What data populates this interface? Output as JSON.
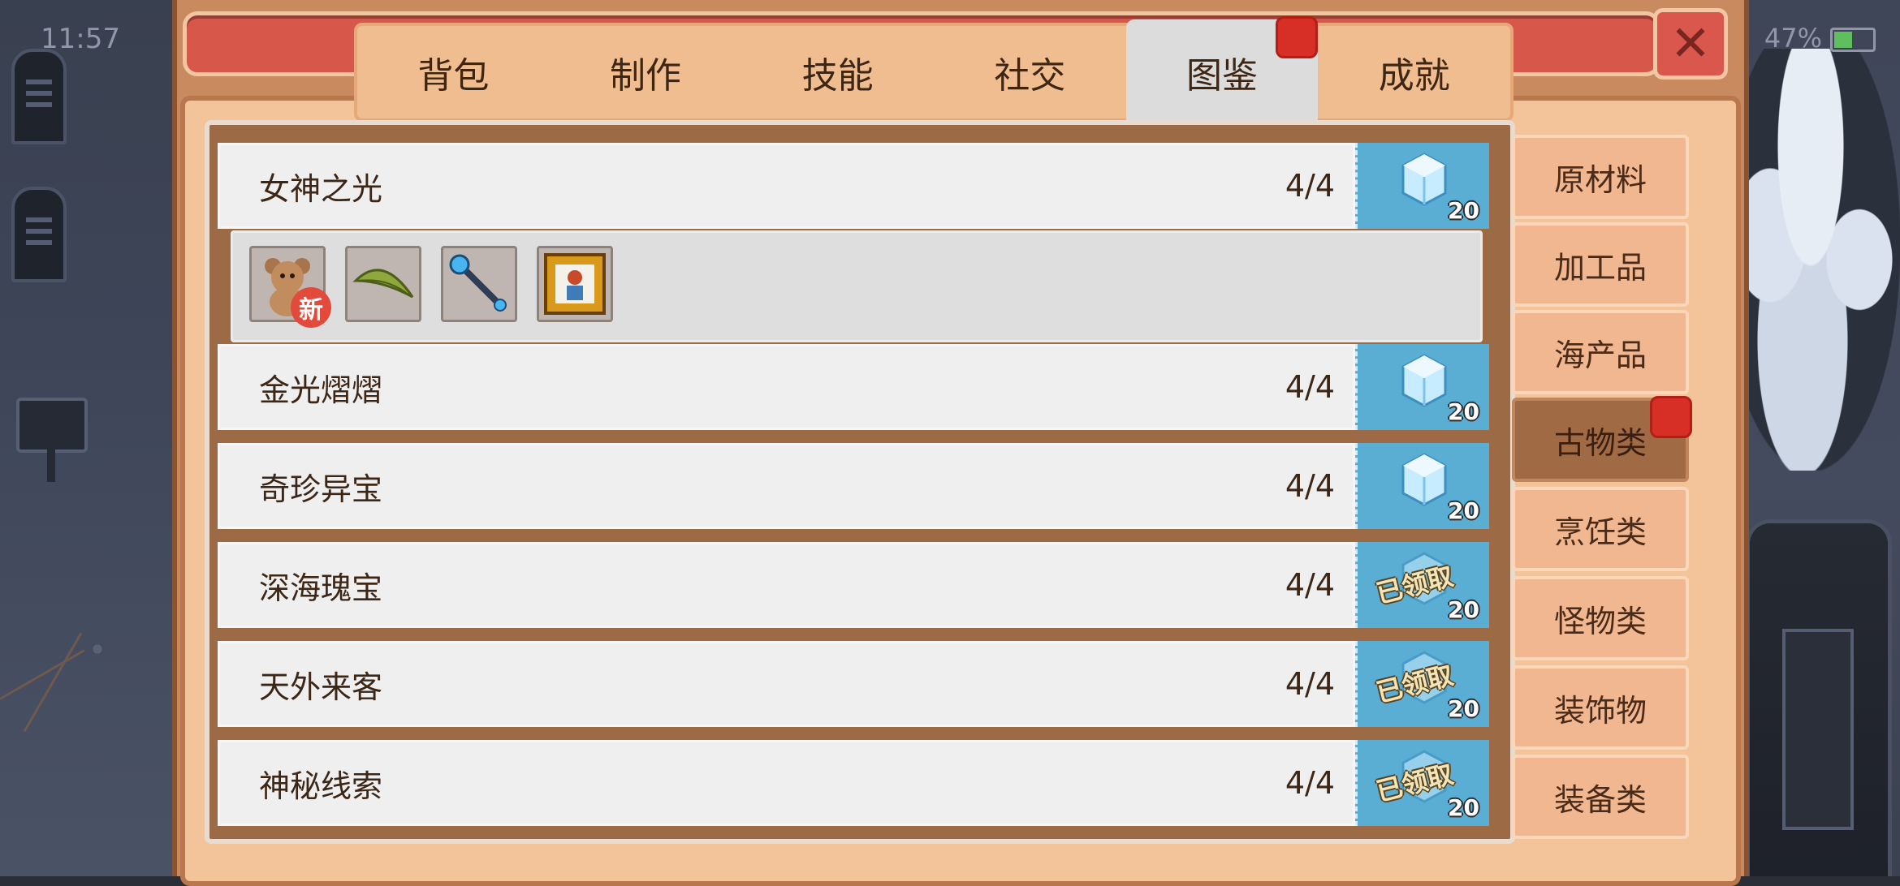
{
  "status_bar": {
    "time": "11:57",
    "battery": "47%"
  },
  "tabs": [
    {
      "label": "背包"
    },
    {
      "label": "制作"
    },
    {
      "label": "技能"
    },
    {
      "label": "社交"
    },
    {
      "label": "图鉴",
      "active": true,
      "has_notification": true
    },
    {
      "label": "成就"
    }
  ],
  "collection_rows": [
    {
      "title": "女神之光",
      "count": "4/4",
      "reward_amount": "20",
      "claimed": false,
      "expanded": true
    },
    {
      "title": "金光熠熠",
      "count": "4/4",
      "reward_amount": "20",
      "claimed": false
    },
    {
      "title": "奇珍异宝",
      "count": "4/4",
      "reward_amount": "20",
      "claimed": false
    },
    {
      "title": "深海瑰宝",
      "count": "4/4",
      "reward_amount": "20",
      "claimed": true,
      "claimed_label": "已领取"
    },
    {
      "title": "天外来客",
      "count": "4/4",
      "reward_amount": "20",
      "claimed": true,
      "claimed_label": "已领取"
    },
    {
      "title": "神秘线索",
      "count": "4/4",
      "reward_amount": "20",
      "claimed": true,
      "claimed_label": "已领取"
    }
  ],
  "expanded_items": [
    {
      "icon": "teddy-bear-icon",
      "new_badge": "新"
    },
    {
      "icon": "leaf-icon"
    },
    {
      "icon": "magic-wand-icon"
    },
    {
      "icon": "portrait-frame-icon"
    }
  ],
  "categories": [
    {
      "label": "原材料"
    },
    {
      "label": "加工品"
    },
    {
      "label": "海产品"
    },
    {
      "label": "古物类",
      "active": true,
      "has_notification": true
    },
    {
      "label": "烹饪类"
    },
    {
      "label": "怪物类"
    },
    {
      "label": "装饰物"
    },
    {
      "label": "装备类"
    }
  ],
  "colors": {
    "accent_red": "#d72f26",
    "panel": "#f3c39a",
    "reward_blue": "#5aaed4"
  }
}
